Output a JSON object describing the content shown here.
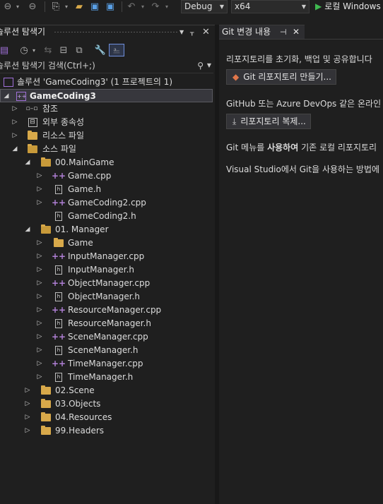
{
  "toolbar": {
    "config": "Debug",
    "platform": "x64",
    "run_label": "로컬 Windows"
  },
  "solution_explorer": {
    "title": "솔루션 탐색기",
    "search_placeholder": "솔루션 탐색기 검색(Ctrl+;)",
    "tree": [
      {
        "label": "솔루션 'GameCoding3'  (1 프로젝트의 1)",
        "kind": "solution"
      },
      {
        "label": "GameCoding3",
        "kind": "project"
      },
      {
        "label": "참조",
        "kind": "references"
      },
      {
        "label": "외부 종속성",
        "kind": "external"
      },
      {
        "label": "리소스 파일",
        "kind": "filter"
      },
      {
        "label": "소스 파일",
        "kind": "filter"
      },
      {
        "label": "00.MainGame",
        "kind": "filter"
      },
      {
        "label": "Game.cpp",
        "kind": "cpp"
      },
      {
        "label": "Game.h",
        "kind": "h"
      },
      {
        "label": "GameCoding2.cpp",
        "kind": "cpp"
      },
      {
        "label": "GameCoding2.h",
        "kind": "h"
      },
      {
        "label": "01. Manager",
        "kind": "filter"
      },
      {
        "label": "Game",
        "kind": "filter"
      },
      {
        "label": "InputManager.cpp",
        "kind": "cpp"
      },
      {
        "label": "InputManager.h",
        "kind": "h"
      },
      {
        "label": "ObjectManager.cpp",
        "kind": "cpp"
      },
      {
        "label": "ObjectManager.h",
        "kind": "h"
      },
      {
        "label": "ResourceManager.cpp",
        "kind": "cpp"
      },
      {
        "label": "ResourceManager.h",
        "kind": "h"
      },
      {
        "label": "SceneManager.cpp",
        "kind": "cpp"
      },
      {
        "label": "SceneManager.h",
        "kind": "h"
      },
      {
        "label": "TimeManager.cpp",
        "kind": "cpp"
      },
      {
        "label": "TimeManager.h",
        "kind": "h"
      },
      {
        "label": "02.Scene",
        "kind": "filter"
      },
      {
        "label": "03.Objects",
        "kind": "filter"
      },
      {
        "label": "04.Resources",
        "kind": "filter"
      },
      {
        "label": "99.Headers",
        "kind": "filter"
      }
    ]
  },
  "git_panel": {
    "tab_label": "Git 변경 내용",
    "intro": "리포지토리를 초기화, 백업 및 공유합니다",
    "create_button": "Git 리포지토리 만들기...",
    "clone_intro": "GitHub 또는 Azure DevOps 같은 온라인 리",
    "clone_button": "리포지토리 복제...",
    "menu_text_a": "Git 메뉴를 ",
    "menu_text_b": "사용하여",
    "menu_text_c": " 기존 로컬 리포지토리",
    "learn_text": "Visual Studio에서 Git을 사용하는 방법에"
  }
}
